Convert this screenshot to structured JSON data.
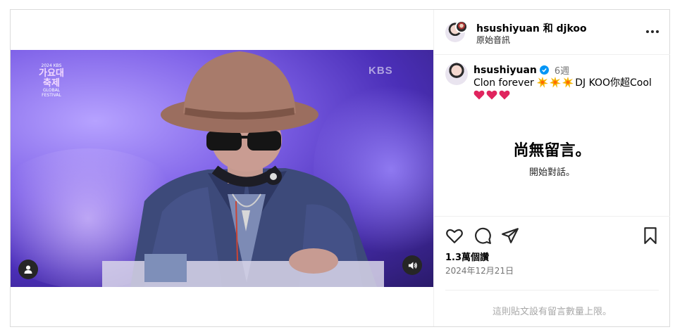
{
  "post": {
    "header": {
      "user1": "hsushiyuan",
      "conj": "和",
      "user2": "djkoo",
      "subtitle": "原始音訊",
      "more_icon": "more-horizontal-icon"
    },
    "video": {
      "overlay_logo_small": "2024 KBS",
      "overlay_logo_big": "가요대축제",
      "overlay_logo_sub": "GLOBAL FESTIVAL",
      "watermark": "KBS",
      "tag_icon": "user-tag-icon",
      "sound_icon": "volume-icon"
    },
    "caption": {
      "username": "hsushiyuan",
      "verified_icon": "verified-badge-icon",
      "time": "6週",
      "text_prefix": "Clon forever",
      "text_suffix": "DJ KOO你超Cool",
      "emoji_burst": "collision-emoji",
      "emoji_heart": "red-heart-emoji"
    },
    "comments": {
      "empty_title": "尚無留言。",
      "empty_sub": "開始對話。"
    },
    "actions": {
      "like_icon": "heart-icon",
      "comment_icon": "comment-icon",
      "share_icon": "share-icon",
      "save_icon": "bookmark-icon",
      "views": "1.3萬個讚",
      "date": "2024年12月21日"
    },
    "footer": {
      "limit_notice": "這則貼文設有留言數量上限。"
    },
    "colors": {
      "verified": "#0095f6",
      "heart": "#e0245e",
      "muted": "#737373"
    }
  }
}
